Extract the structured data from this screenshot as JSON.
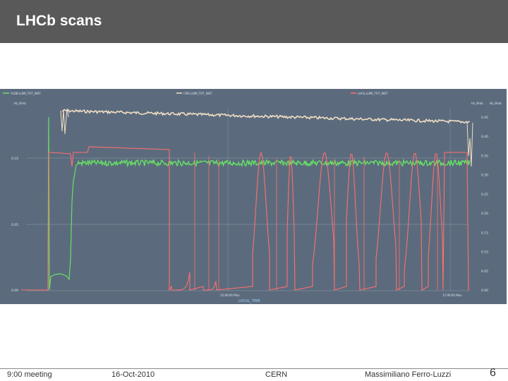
{
  "slide": {
    "title": "LHCb scans",
    "page_number": "6"
  },
  "footer": {
    "meeting": "9:00 meeting",
    "date": "16-Oct-2010",
    "org": "CERN",
    "author": "Massimiliano Ferro-Luzzi"
  },
  "plot": {
    "legend": [
      "VLDB.LUMI_TOT_INST",
      "CMS.LUMI_TOT_INST",
      "LHCb.LUMI_TOT_INST"
    ],
    "left_unit": "Hz_Ѳmb",
    "right_units": [
      "Hz_Ѳmb",
      "Hz_Ѳmb"
    ],
    "left_ticks": [
      "0.10",
      "0.05",
      "0.00"
    ],
    "right_ticks": [
      "0.45",
      "0.40",
      "0.35",
      "0.30",
      "0.25",
      "0.20",
      "0.15",
      "0.10",
      "0.05",
      "0.00"
    ],
    "x_ticks": [
      "15:00:00 Mon",
      "17:00:00 Mon"
    ],
    "x_label": "LOCAL_TIME",
    "colors": {
      "background": "#5b6b7d",
      "grid": "#7d8c9c",
      "cream": "#f2dec4",
      "green": "#66e066",
      "red": "#ff6e6e"
    }
  }
}
